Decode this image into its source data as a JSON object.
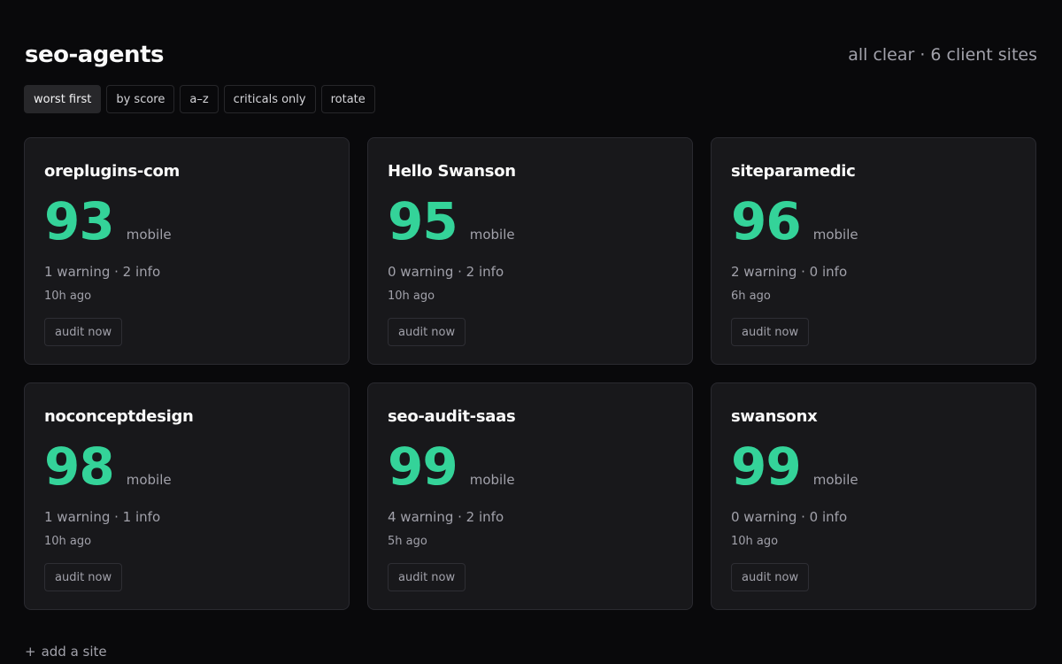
{
  "header": {
    "title": "seo-agents",
    "status": "all clear · 6 client sites"
  },
  "filters": [
    {
      "label": "worst first",
      "active": true
    },
    {
      "label": "by score",
      "active": false
    },
    {
      "label": "a–z",
      "active": false
    },
    {
      "label": "criticals only",
      "active": false
    },
    {
      "label": "rotate",
      "active": false
    }
  ],
  "sites": [
    {
      "name": "oreplugins-com",
      "score": "93",
      "device": "mobile",
      "issues": "1 warning · 2 info",
      "time": "10h ago",
      "action": "audit now"
    },
    {
      "name": "Hello Swanson",
      "score": "95",
      "device": "mobile",
      "issues": "0 warning · 2 info",
      "time": "10h ago",
      "action": "audit now"
    },
    {
      "name": "siteparamedic",
      "score": "96",
      "device": "mobile",
      "issues": "2 warning · 0 info",
      "time": "6h ago",
      "action": "audit now"
    },
    {
      "name": "noconceptdesign",
      "score": "98",
      "device": "mobile",
      "issues": "1 warning · 1 info",
      "time": "10h ago",
      "action": "audit now"
    },
    {
      "name": "seo-audit-saas",
      "score": "99",
      "device": "mobile",
      "issues": "4 warning · 2 info",
      "time": "5h ago",
      "action": "audit now"
    },
    {
      "name": "swansonx",
      "score": "99",
      "device": "mobile",
      "issues": "0 warning · 0 info",
      "time": "10h ago",
      "action": "audit now"
    }
  ],
  "add_site": {
    "icon": "plus-icon",
    "label": "add a site"
  },
  "colors": {
    "background": "#09090b",
    "card": "#18181b",
    "score_good": "#34d399",
    "active_filter": "#27272a"
  }
}
